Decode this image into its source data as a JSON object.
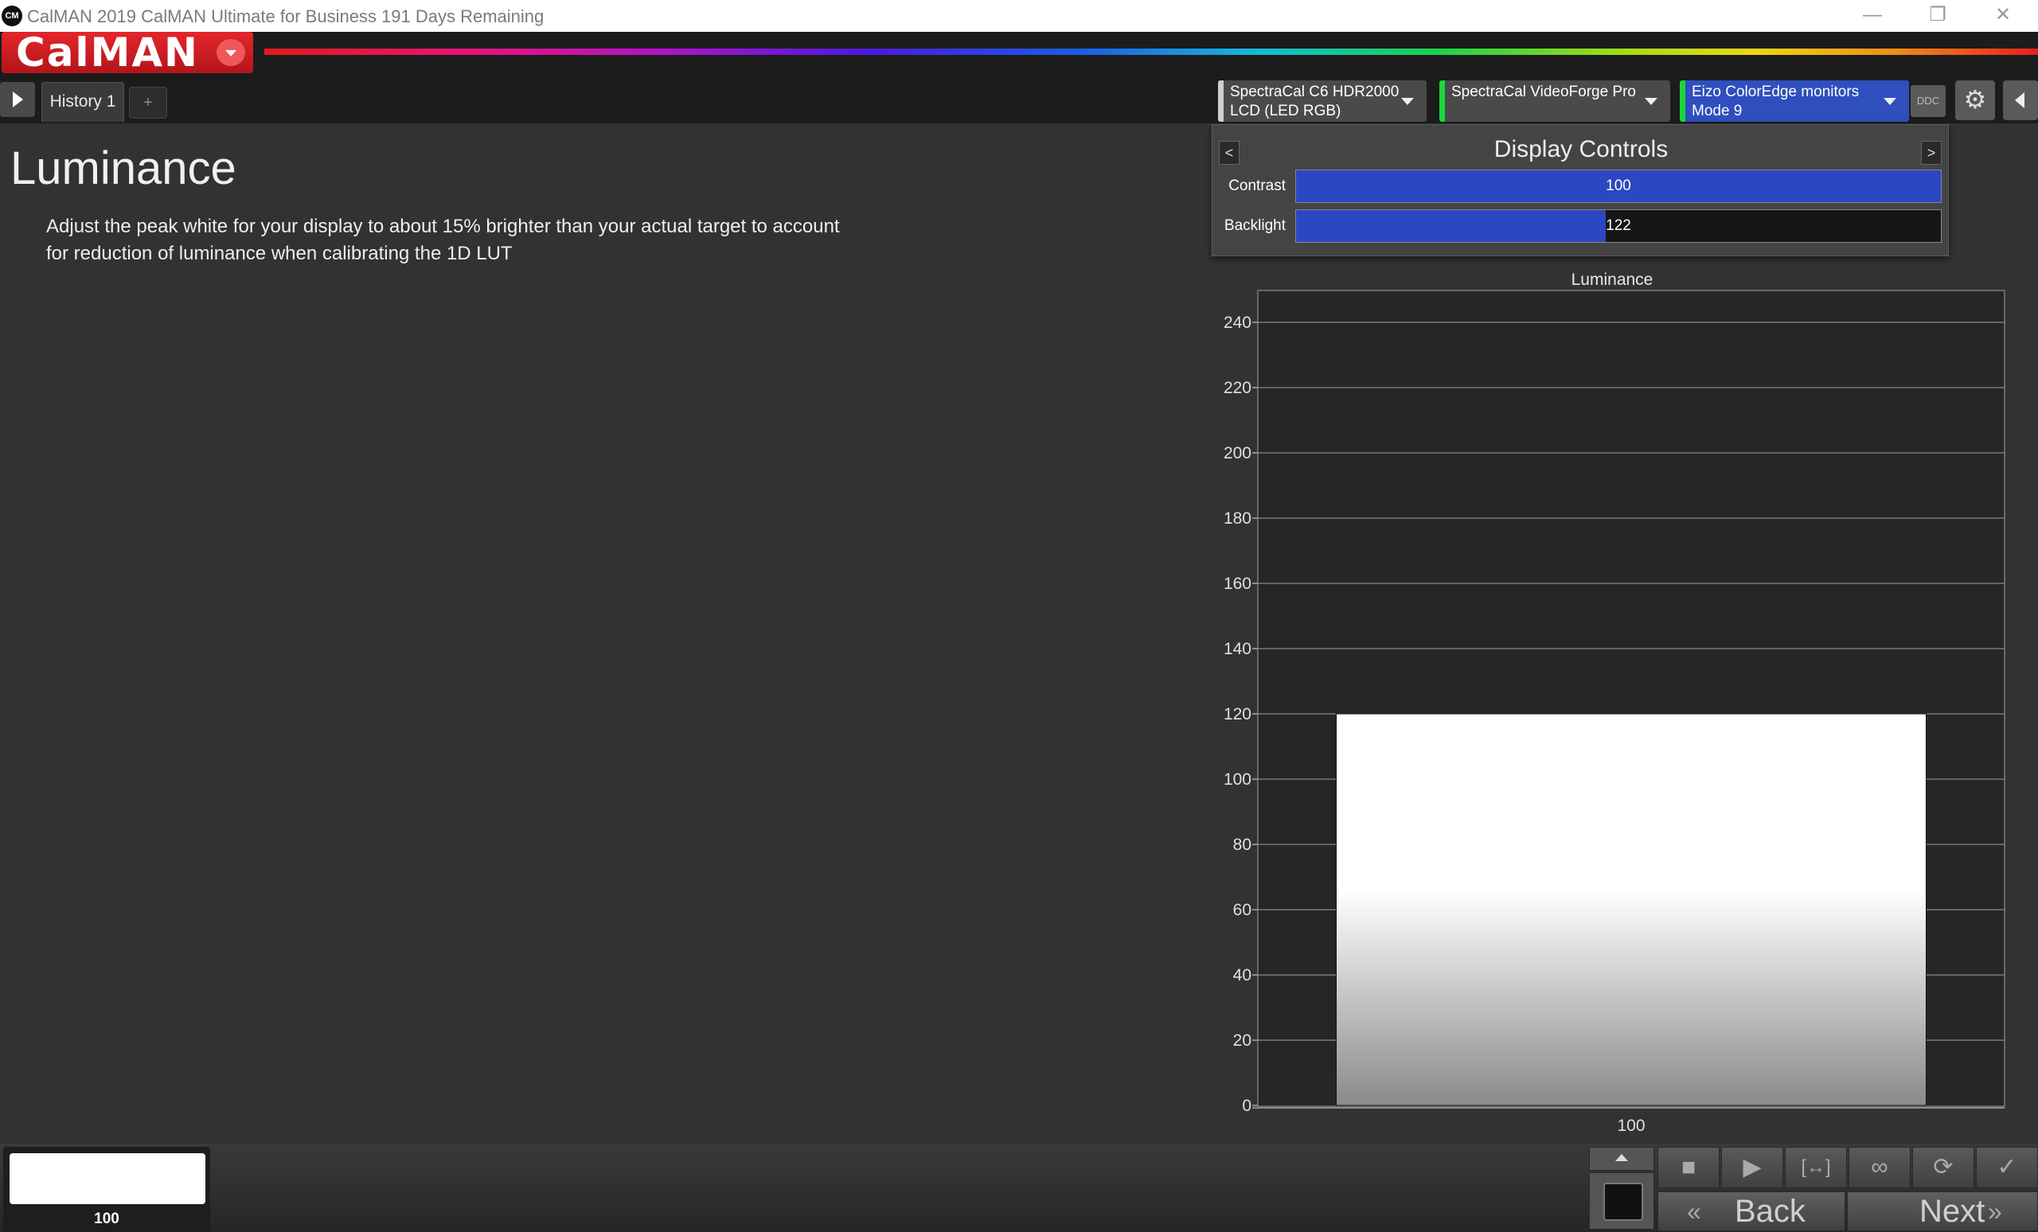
{
  "window": {
    "title": "CalMAN 2019 CalMAN Ultimate for Business 191 Days Remaining",
    "icon_text": "CM",
    "minimize_icon": "minimize-icon",
    "restore_icon": "restore-icon",
    "close_icon": "close-icon"
  },
  "header": {
    "logo_text": "CalMAN",
    "rainbow_colors": [
      "#e41b1b",
      "#e4147a",
      "#b414c8",
      "#4b1adc",
      "#1a5ee4",
      "#19b9d8",
      "#1ad24a",
      "#9cdc18",
      "#ecd816",
      "#f08c16",
      "#e81e1e"
    ]
  },
  "tabs": [
    {
      "label": "History 1",
      "active": true
    }
  ],
  "tab_add_label": "+",
  "devices": {
    "meter": {
      "line1": "SpectraCal C6 HDR2000",
      "line2": "LCD (LED RGB)"
    },
    "generator": {
      "line1": "SpectraCal VideoForge Pro",
      "line2": ""
    },
    "display": {
      "line1": "Eizo ColorEdge monitors",
      "line2": "Mode 9"
    },
    "ddc_label": "DDC",
    "accent_green": "#1cd63a",
    "display_bg": "#2f4fbf"
  },
  "main": {
    "title": "Luminance",
    "instructions": "Adjust the peak white for your display to about 15% brighter than your actual target to account for reduction of luminance when calibrating the 1D LUT"
  },
  "display_controls": {
    "title": "Display Controls",
    "prev_label": "<",
    "next_label": ">",
    "controls": [
      {
        "label": "Contrast",
        "value": "100",
        "fill_fraction": 1.0
      },
      {
        "label": "Backlight",
        "value": "122",
        "fill_fraction": 0.48
      }
    ],
    "fill_color": "#2c47c2"
  },
  "chart_data": {
    "type": "bar",
    "title": "Luminance",
    "categories": [
      "100"
    ],
    "values": [
      120
    ],
    "ylim": [
      0,
      250
    ],
    "yticks": [
      0,
      20,
      40,
      60,
      80,
      100,
      120,
      140,
      160,
      180,
      200,
      220,
      240
    ],
    "grid": true,
    "xlabel": "",
    "ylabel": "",
    "bar_color": "#ffffff"
  },
  "bottom": {
    "swatch_label": "100",
    "swatch_color": "#ffffff",
    "back_label": "Back",
    "next_label": "Next",
    "controls": [
      "stop-icon",
      "play-icon",
      "read-series-icon",
      "continuous-icon",
      "refresh-icon",
      "check-icon"
    ]
  }
}
